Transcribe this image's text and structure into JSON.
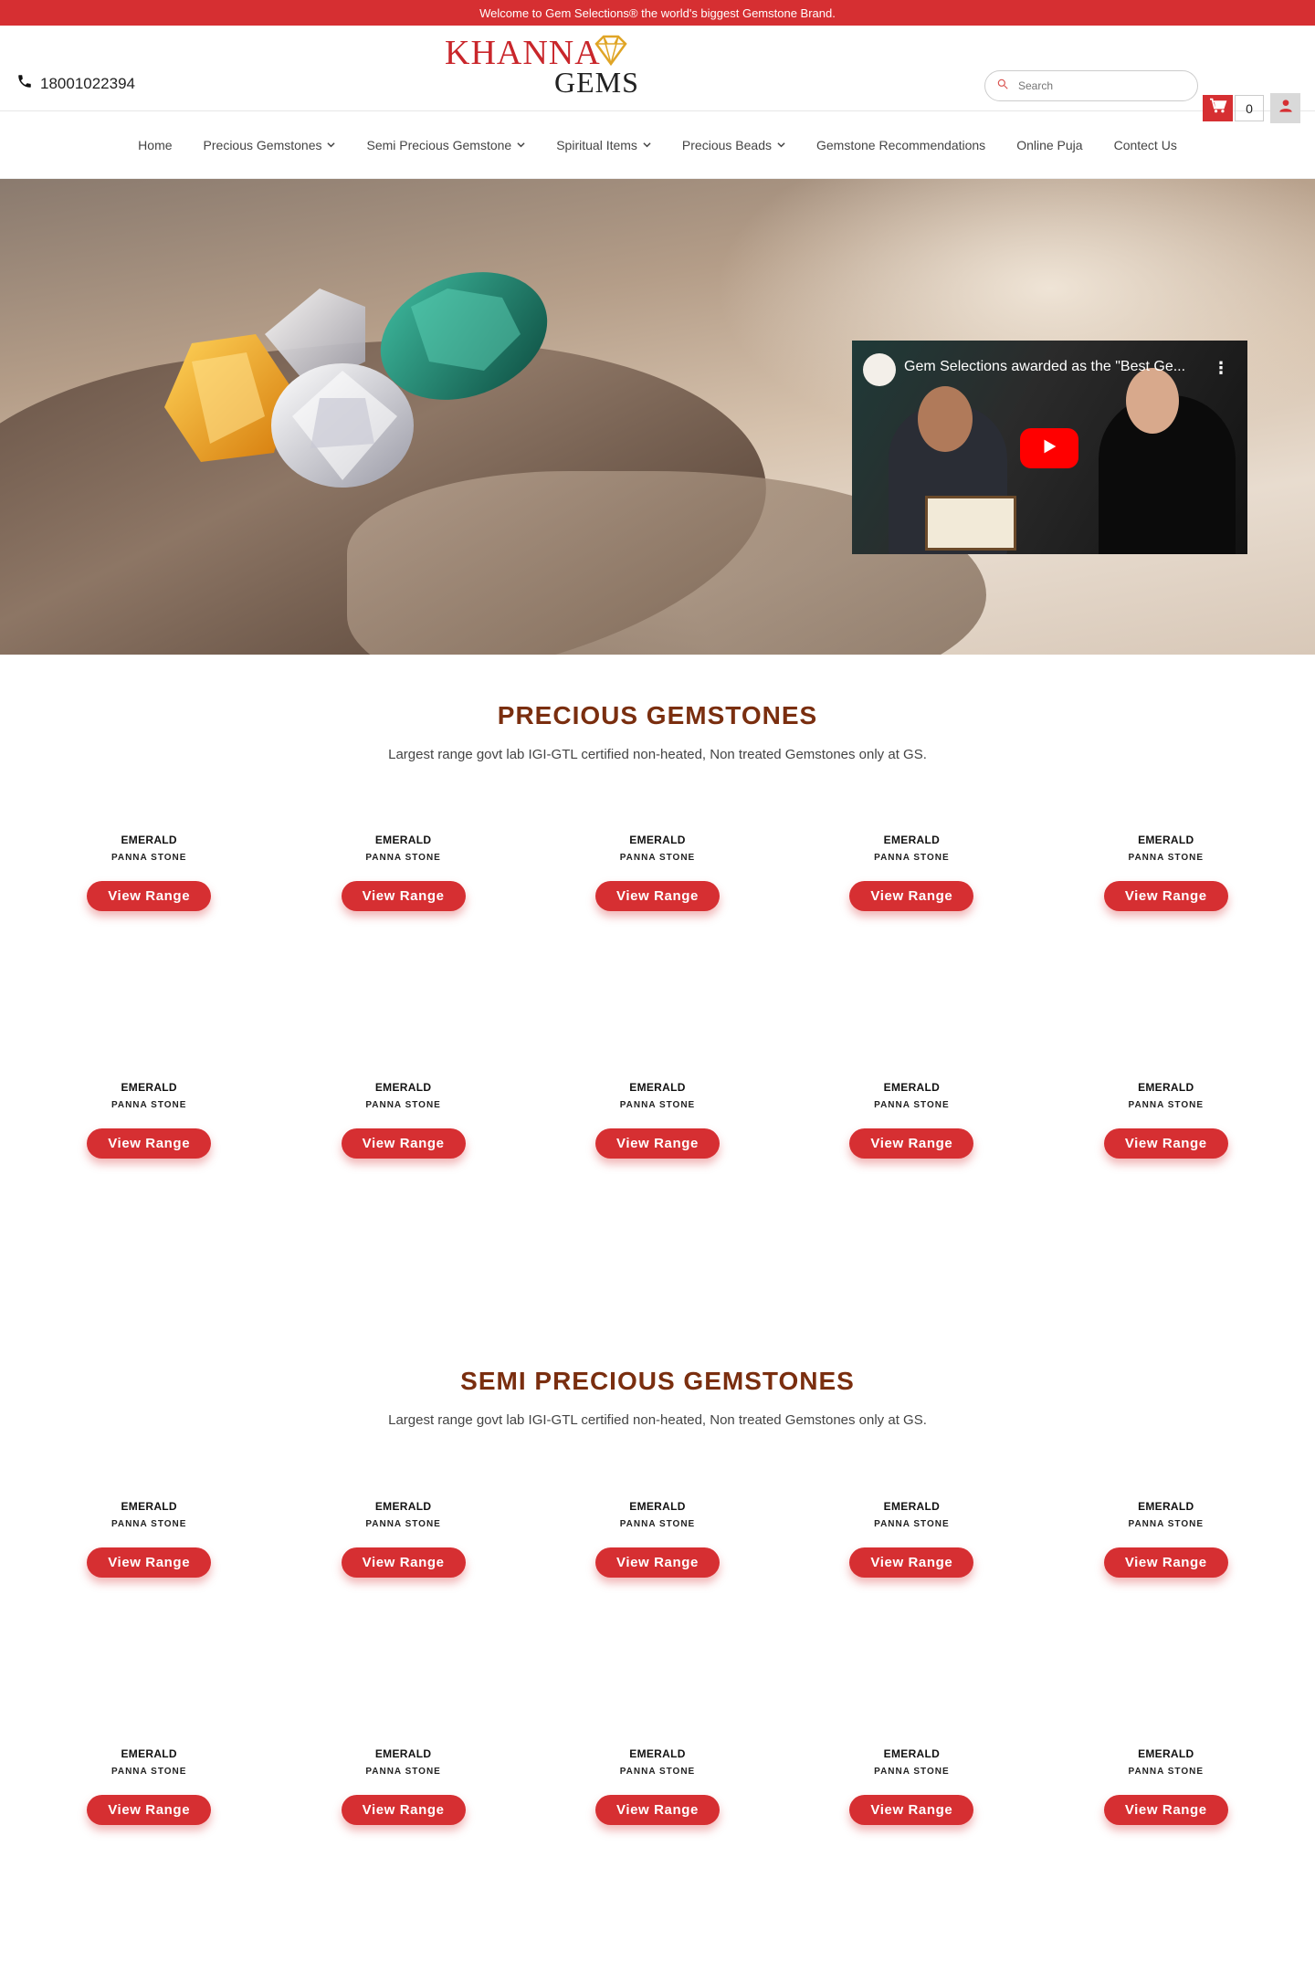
{
  "topbar": {
    "text": "Welcome to Gem Selections® the world's biggest Gemstone Brand."
  },
  "header": {
    "phone": "18001022394",
    "logo_line1": "KHANNA",
    "logo_line2": "GEMS",
    "search_placeholder": "Search",
    "cart_count": "0",
    "icons": [
      "phone-icon",
      "search-icon",
      "cart-icon",
      "user-icon"
    ],
    "accent_color": "#d62f32"
  },
  "nav": {
    "items": [
      {
        "label": "Home",
        "dropdown": false
      },
      {
        "label": "Precious Gemstones",
        "dropdown": true
      },
      {
        "label": "Semi Precious Gemstone",
        "dropdown": true
      },
      {
        "label": "Spiritual Items",
        "dropdown": true
      },
      {
        "label": "Precious Beads",
        "dropdown": true
      },
      {
        "label": "Gemstone Recommendations",
        "dropdown": false
      },
      {
        "label": "Online Puja",
        "dropdown": false
      },
      {
        "label": "Contect Us",
        "dropdown": false
      }
    ]
  },
  "hero": {
    "video_title": "Gem Selections awarded as the \"Best Ge...",
    "video_more": "⋮"
  },
  "precious": {
    "title": "PRECIOUS GEMSTONES",
    "subtitle": "Largest range govt lab IGI-GTL certified non-heated, Non treated Gemstones only at GS.",
    "cards": [
      {
        "name": "EMERALD",
        "sub": "PANNA STONE",
        "button": "View Range"
      },
      {
        "name": "EMERALD",
        "sub": "PANNA STONE",
        "button": "View Range"
      },
      {
        "name": "EMERALD",
        "sub": "PANNA STONE",
        "button": "View Range"
      },
      {
        "name": "EMERALD",
        "sub": "PANNA STONE",
        "button": "View Range"
      },
      {
        "name": "EMERALD",
        "sub": "PANNA STONE",
        "button": "View Range"
      },
      {
        "name": "EMERALD",
        "sub": "PANNA STONE",
        "button": "View Range"
      },
      {
        "name": "EMERALD",
        "sub": "PANNA STONE",
        "button": "View Range"
      },
      {
        "name": "EMERALD",
        "sub": "PANNA STONE",
        "button": "View Range"
      },
      {
        "name": "EMERALD",
        "sub": "PANNA STONE",
        "button": "View Range"
      },
      {
        "name": "EMERALD",
        "sub": "PANNA STONE",
        "button": "View Range"
      }
    ]
  },
  "semi_precious": {
    "title": "SEMI PRECIOUS GEMSTONES",
    "subtitle": "Largest range govt lab IGI-GTL certified non-heated, Non treated Gemstones only at GS.",
    "cards": [
      {
        "name": "EMERALD",
        "sub": "PANNA STONE",
        "button": "View Range"
      },
      {
        "name": "EMERALD",
        "sub": "PANNA STONE",
        "button": "View Range"
      },
      {
        "name": "EMERALD",
        "sub": "PANNA STONE",
        "button": "View Range"
      },
      {
        "name": "EMERALD",
        "sub": "PANNA STONE",
        "button": "View Range"
      },
      {
        "name": "EMERALD",
        "sub": "PANNA STONE",
        "button": "View Range"
      },
      {
        "name": "EMERALD",
        "sub": "PANNA STONE",
        "button": "View Range"
      },
      {
        "name": "EMERALD",
        "sub": "PANNA STONE",
        "button": "View Range"
      },
      {
        "name": "EMERALD",
        "sub": "PANNA STONE",
        "button": "View Range"
      },
      {
        "name": "EMERALD",
        "sub": "PANNA STONE",
        "button": "View Range"
      },
      {
        "name": "EMERALD",
        "sub": "PANNA STONE",
        "button": "View Range"
      }
    ]
  }
}
